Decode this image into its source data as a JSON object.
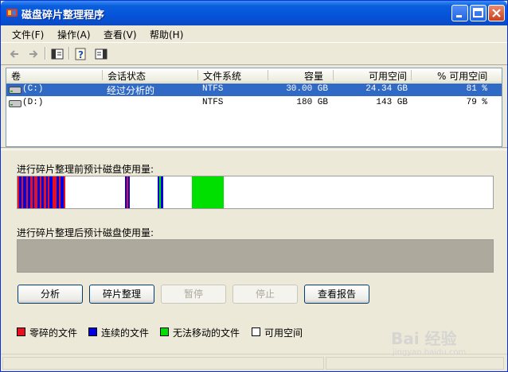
{
  "window": {
    "title": "磁盘碎片整理程序"
  },
  "menu": [
    "文件(F)",
    "操作(A)",
    "查看(V)",
    "帮助(H)"
  ],
  "toolbar": {
    "icons": [
      "back-arrow-icon",
      "forward-arrow-icon",
      "properties-icon",
      "help-icon",
      "view-icon"
    ]
  },
  "volume_list": {
    "columns": [
      "卷",
      "会话状态",
      "文件系统",
      "容量",
      "可用空间",
      "% 可用空间"
    ],
    "rows": [
      {
        "volume": "(C:)",
        "status": "经过分析的",
        "fs": "NTFS",
        "capacity": "30.00 GB",
        "free": "24.34 GB",
        "pct": "81 %",
        "selected": true
      },
      {
        "volume": "(D:)",
        "status": "",
        "fs": "NTFS",
        "capacity": "180 GB",
        "free": "143 GB",
        "pct": "79 %",
        "selected": false
      }
    ]
  },
  "before_label": "进行碎片整理前预计磁盘使用量:",
  "after_label": "进行碎片整理后预计磁盘使用量:",
  "buttons": {
    "analyze": "分析",
    "defrag": "碎片整理",
    "pause": "暂停",
    "stop": "停止",
    "report": "查看报告"
  },
  "legend": [
    {
      "label": "零碎的文件",
      "color": "#e8101a"
    },
    {
      "label": "连续的文件",
      "color": "#0000e0"
    },
    {
      "label": "无法移动的文件",
      "color": "#00e000"
    },
    {
      "label": "可用空间",
      "color": "#ffffff"
    }
  ],
  "colors": {
    "fragmented": "#e8101a",
    "contiguous": "#0000e0",
    "unmovable": "#00e000",
    "free": "#ffffff",
    "selection": "#316ac5"
  },
  "watermark": {
    "text": "Bai 经验",
    "sub": "jingyan.baidu.com"
  }
}
